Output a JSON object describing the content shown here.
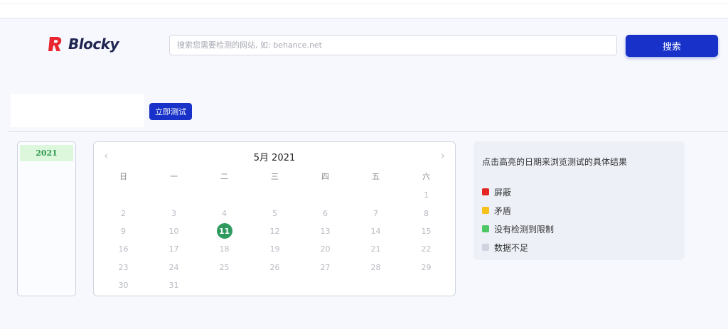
{
  "brand": {
    "name": "Blocky",
    "icon": "blocky-logo-icon",
    "color": "#e8262f"
  },
  "search": {
    "placeholder": "搜索您需要检测的网站, 如: behance.net",
    "value": "",
    "button_label": "搜索"
  },
  "test": {
    "button_label": "立即测试"
  },
  "years": [
    "2021"
  ],
  "calendar": {
    "title": "5月 2021",
    "prev_icon": "chevron-left-icon",
    "next_icon": "chevron-right-icon",
    "weekdays": [
      "日",
      "一",
      "二",
      "三",
      "四",
      "五",
      "六"
    ],
    "weeks": [
      [
        "",
        "",
        "",
        "",
        "",
        "",
        "1"
      ],
      [
        "2",
        "3",
        "4",
        "5",
        "6",
        "7",
        "8"
      ],
      [
        "9",
        "10",
        "11",
        "12",
        "13",
        "14",
        "15"
      ],
      [
        "16",
        "17",
        "18",
        "19",
        "20",
        "21",
        "22"
      ],
      [
        "23",
        "24",
        "25",
        "26",
        "27",
        "28",
        "29"
      ],
      [
        "30",
        "31",
        "",
        "",
        "",
        "",
        ""
      ]
    ],
    "highlighted_day": "11",
    "highlight_color": "#2e9a5e"
  },
  "legend": {
    "title": "点击高亮的日期来浏览测试的具体结果",
    "items": [
      {
        "label": "屏蔽",
        "color": "#e52521"
      },
      {
        "label": "矛盾",
        "color": "#f5c11a"
      },
      {
        "label": "没有检测到限制",
        "color": "#4cc763"
      },
      {
        "label": "数据不足",
        "color": "#d3d3df"
      }
    ]
  },
  "colors": {
    "accent": "#1731c9",
    "background": "#f7f8fd"
  }
}
